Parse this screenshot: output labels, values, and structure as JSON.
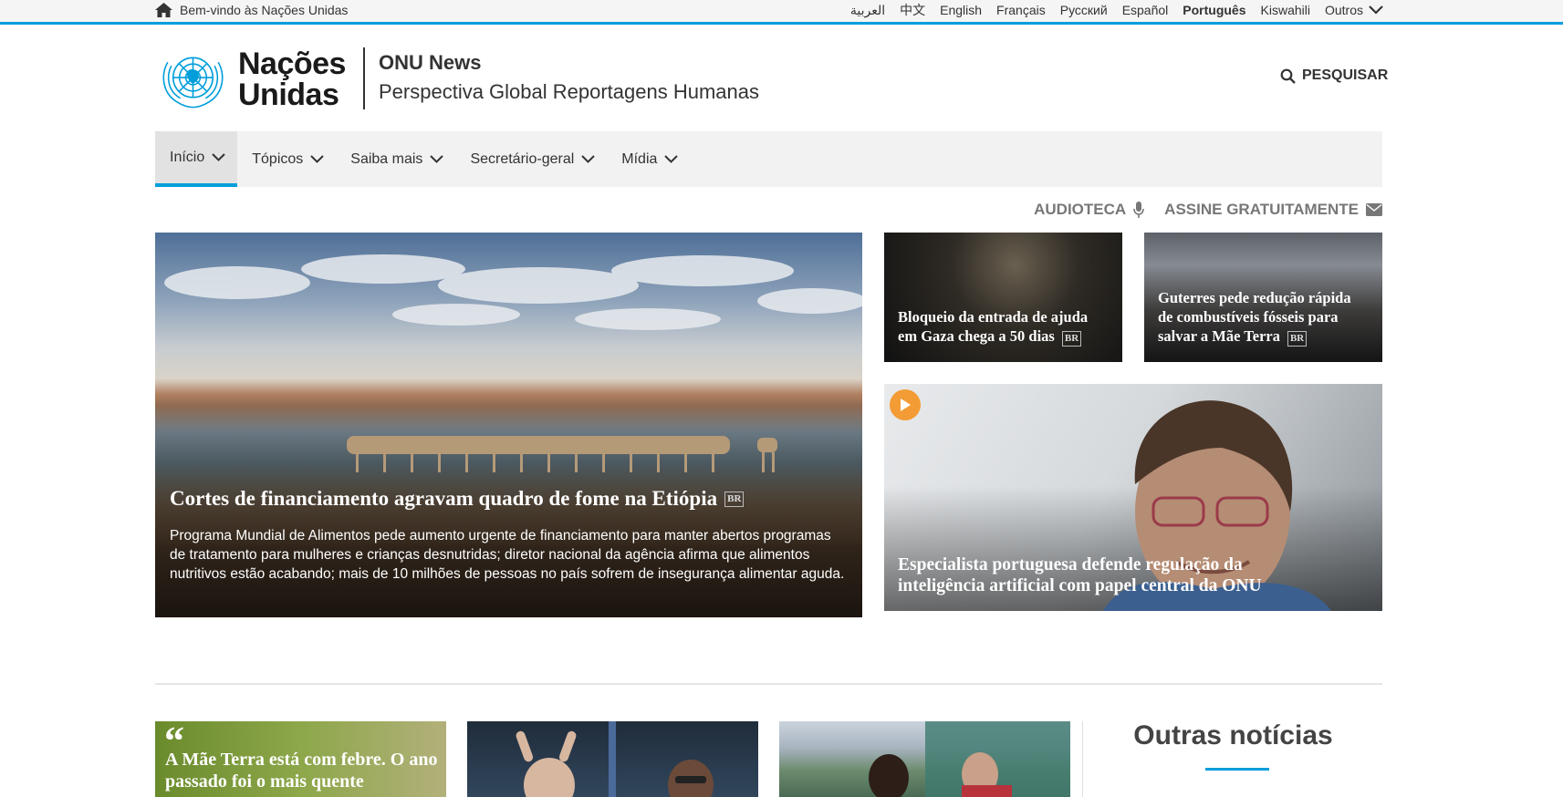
{
  "topbar": {
    "welcome": "Bem-vindo às Nações Unidas",
    "languages": [
      {
        "label": "العربية",
        "active": false
      },
      {
        "label": "中文",
        "active": false
      },
      {
        "label": "English",
        "active": false
      },
      {
        "label": "Français",
        "active": false
      },
      {
        "label": "Русский",
        "active": false
      },
      {
        "label": "Español",
        "active": false
      },
      {
        "label": "Português",
        "active": true
      },
      {
        "label": "Kiswahili",
        "active": false
      }
    ],
    "others_label": "Outros"
  },
  "header": {
    "org_name_line1": "Nações",
    "org_name_line2": "Unidas",
    "site_title": "ONU News",
    "site_subtitle": "Perspectiva Global Reportagens Humanas",
    "search_label": "PESQUISAR"
  },
  "nav": {
    "items": [
      {
        "label": "Início",
        "active": true
      },
      {
        "label": "Tópicos",
        "active": false
      },
      {
        "label": "Saiba mais",
        "active": false
      },
      {
        "label": "Secretário-geral",
        "active": false
      },
      {
        "label": "Mídia",
        "active": false
      }
    ]
  },
  "sublinks": {
    "audioteca": "AUDIOTECA",
    "subscribe": "ASSINE GRATUITAMENTE"
  },
  "hero": {
    "title": "Cortes de financiamento agravam quadro de fome na Etiópia",
    "badge": "BR",
    "description": "Programa Mundial de Alimentos pede aumento urgente de financiamento para manter abertos programas de tratamento para mulheres e crianças desnutridas; diretor nacional da agência afirma que alimentos nutritivos estão acabando; mais de 10 milhões de pessoas no país sofrem de insegurança alimentar aguda."
  },
  "cards": {
    "gaza": {
      "title": "Bloqueio da entrada de ajuda em Gaza chega a 50 dias",
      "badge": "BR"
    },
    "guterres": {
      "title": "Guterres pede redução rápida de combustíveis fósseis para salvar a Mãe Terra",
      "badge": "BR"
    },
    "specialist": {
      "title": "Especialista portuguesa defende regulação da inteligência artificial com papel central da ONU"
    }
  },
  "bottom": {
    "quote_text": "A Mãe Terra está com febre. O ano passado foi o mais quente",
    "outras_title": "Outras notícias"
  },
  "colors": {
    "accent": "#009edb",
    "play": "#f39c35"
  }
}
